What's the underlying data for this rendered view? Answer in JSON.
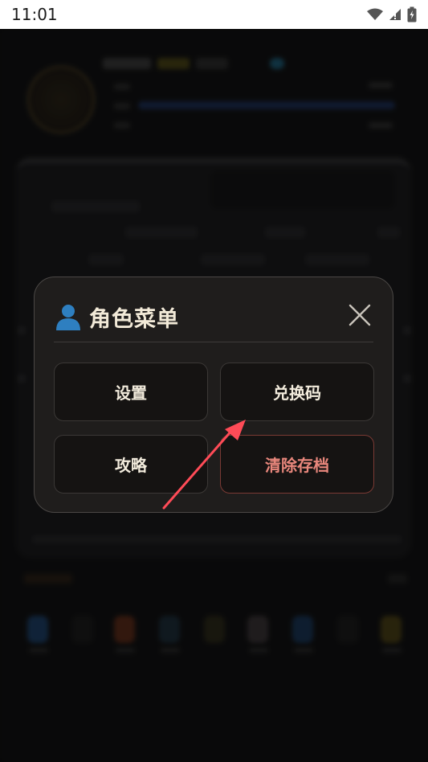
{
  "status_bar": {
    "time": "11:01",
    "icons": [
      "wifi-icon",
      "signal-icon",
      "battery-icon"
    ]
  },
  "dialog": {
    "title": "角色菜单",
    "icon": "person-icon",
    "close_icon": "close-icon",
    "buttons": [
      {
        "label": "设置"
      },
      {
        "label": "兑换码"
      },
      {
        "label": "攻略"
      },
      {
        "label": "清除存档"
      }
    ]
  },
  "colors": {
    "dialog_bg": "#1f1d1c",
    "title_text": "#f2ead8",
    "button_text": "#f3ecdd",
    "danger_text": "#e9877c",
    "danger_border": "#7b3a34",
    "accent_icon": "#2e7fc0",
    "annotation_arrow": "#ff4b57"
  }
}
